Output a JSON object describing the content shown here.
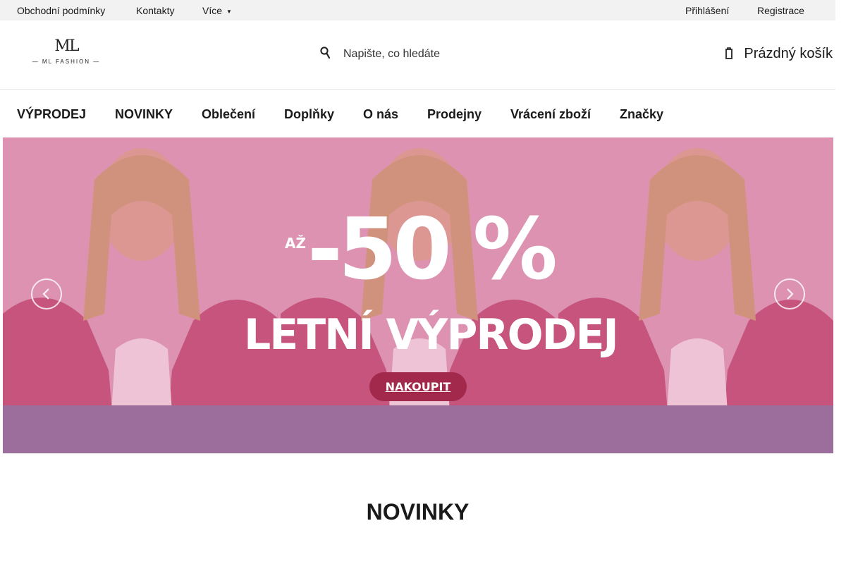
{
  "topbar": {
    "links": [
      "Obchodní podmínky",
      "Kontakty",
      "Více"
    ],
    "account": [
      "Přihlášení",
      "Registrace"
    ]
  },
  "header": {
    "logo": {
      "mark": "ML",
      "tagline": "— ML FASHION —"
    },
    "search": {
      "placeholder": "Napište, co hledáte"
    },
    "cart_label": "Prázdný košík"
  },
  "nav": {
    "items": [
      "VÝPRODEJ",
      "NOVINKY",
      "Oblečení",
      "Doplňky",
      "O nás",
      "Prodejny",
      "Vrácení zboží",
      "Značky"
    ]
  },
  "hero": {
    "lead": "AŽ",
    "discount": "-50 %",
    "title": "LETNÍ VÝPRODEJ",
    "cta": "NAKOUPIT"
  },
  "section": {
    "title": "NOVINKY"
  },
  "colors": {
    "accent": "#a3294c",
    "topbar_bg": "#f2f2f2",
    "hero_bg": "#c45d83"
  }
}
